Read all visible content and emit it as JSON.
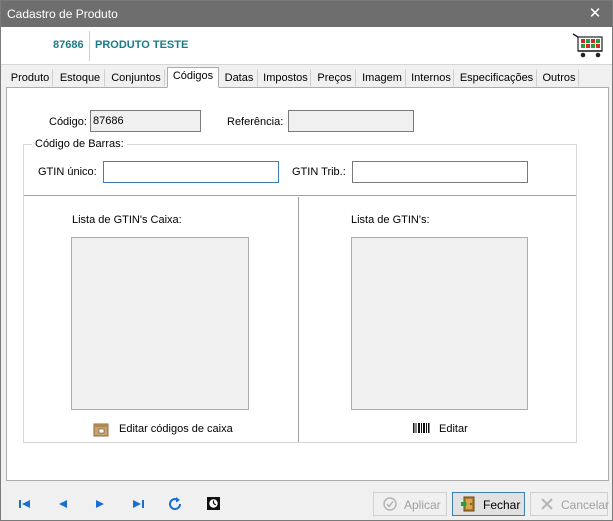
{
  "window": {
    "title": "Cadastro de Produto",
    "close_glyph": "✕"
  },
  "header": {
    "code": "87686",
    "name": "PRODUTO TESTE",
    "icon": "shopping-cart-icon"
  },
  "tabs": [
    {
      "label": "Produto",
      "active": false
    },
    {
      "label": "Estoque",
      "active": false
    },
    {
      "label": "Conjuntos",
      "active": false
    },
    {
      "label": "Códigos",
      "active": true
    },
    {
      "label": "Datas",
      "active": false
    },
    {
      "label": "Impostos",
      "active": false
    },
    {
      "label": "Preços",
      "active": false
    },
    {
      "label": "Imagem",
      "active": false
    },
    {
      "label": "Internos",
      "active": false
    },
    {
      "label": "Especificações",
      "active": false
    },
    {
      "label": "Outros",
      "active": false
    }
  ],
  "form": {
    "codigo_label": "Código:",
    "codigo_value": "87686",
    "referencia_label": "Referência:",
    "referencia_value": "",
    "barcode_group_label": "Código de Barras:",
    "gtin_unico_label": "GTIN único:",
    "gtin_unico_value": "",
    "gtin_trib_label": "GTIN Trib.:",
    "gtin_trib_value": ""
  },
  "lists": {
    "caixa_label": "Lista de GTIN's Caixa:",
    "caixa_button": "Editar códigos de caixa",
    "gtins_label": "Lista de GTIN's:",
    "gtins_button": "Editar"
  },
  "buttons": {
    "aplicar": "Aplicar",
    "fechar": "Fechar",
    "cancelar": "Cancelar"
  },
  "colors": {
    "accent": "#1b7c86",
    "titlebar": "#6e6e6e",
    "nav": "#1a6fd0"
  }
}
